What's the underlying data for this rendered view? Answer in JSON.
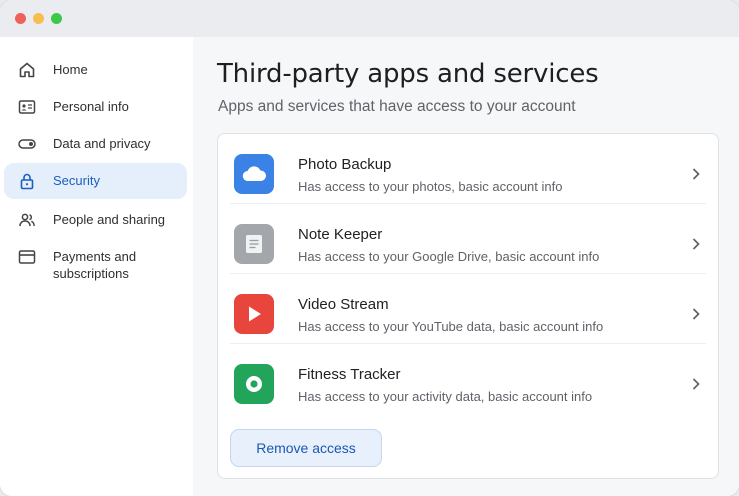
{
  "sidebar": {
    "items": [
      {
        "label": "Home",
        "icon": "home-icon",
        "active": false
      },
      {
        "label": "Personal info",
        "icon": "id-card-icon",
        "active": false
      },
      {
        "label": "Data and privacy",
        "icon": "toggle-icon",
        "active": false
      },
      {
        "label": "Security",
        "icon": "lock-icon",
        "active": true
      },
      {
        "label": "People and sharing",
        "icon": "people-icon",
        "active": false
      },
      {
        "label": "Payments and subscriptions",
        "icon": "credit-card-icon",
        "active": false
      }
    ]
  },
  "main": {
    "title": "Third-party apps and services",
    "subtitle": "Apps and services that have access to your account",
    "apps": [
      {
        "name": "Photo Backup",
        "description": "Has access to your photos, basic account info",
        "icon": "cloud-icon",
        "color": "#3b82e6"
      },
      {
        "name": "Note Keeper",
        "description": "Has access to your Google Drive, basic account info",
        "icon": "note-icon",
        "color": "#a3a6ab"
      },
      {
        "name": "Video Stream",
        "description": "Has access to your YouTube data, basic account info",
        "icon": "play-icon",
        "color": "#e8453c"
      },
      {
        "name": "Fitness Tracker",
        "description": "Has access to your activity data, basic account info",
        "icon": "target-icon",
        "color": "#22a45b"
      }
    ],
    "remove_label": "Remove access"
  },
  "colors": {
    "accent": "#1a57b6",
    "active_bg": "#e5eefb"
  }
}
